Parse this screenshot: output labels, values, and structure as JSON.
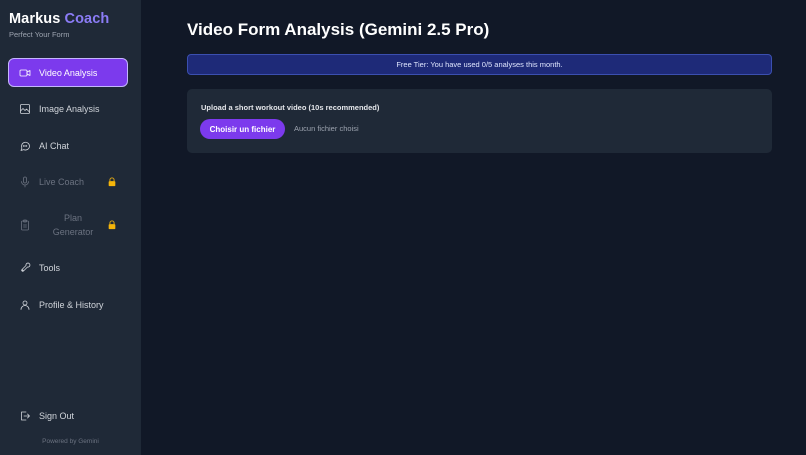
{
  "brand": {
    "name": "Markus",
    "accent": "Coach",
    "tagline": "Perfect Your Form"
  },
  "sidebar": {
    "items": [
      {
        "label": "Video Analysis",
        "icon": "video-icon",
        "active": true,
        "locked": false
      },
      {
        "label": "Image Analysis",
        "icon": "image-icon",
        "active": false,
        "locked": false
      },
      {
        "label": "AI Chat",
        "icon": "chat-bubble-icon",
        "active": false,
        "locked": false
      },
      {
        "label": "Live Coach",
        "icon": "microphone-icon",
        "active": false,
        "locked": true
      },
      {
        "label": "Plan Generator",
        "label_line1": "Plan",
        "label_line2": "Generator",
        "icon": "clipboard-icon",
        "active": false,
        "locked": true
      },
      {
        "label": "Tools",
        "icon": "tools-icon",
        "active": false,
        "locked": false
      },
      {
        "label": "Profile & History",
        "icon": "user-icon",
        "active": false,
        "locked": false
      }
    ],
    "sign_out": "Sign Out",
    "powered_by": "Powered by Gemini"
  },
  "main": {
    "title": "Video Form Analysis (Gemini 2.5 Pro)",
    "banner": "Free Tier: You have used 0/5 analyses this month.",
    "upload": {
      "label": "Upload a short workout video (10s recommended)",
      "button_label": "Choisir un fichier",
      "file_status": "Aucun fichier choisi"
    }
  },
  "colors": {
    "background": "#111827",
    "sidebar": "#1f2937",
    "accent": "#7c3aed",
    "brand_accent": "#8b7cf6",
    "lock": "#f5b50a",
    "banner_bg": "#1e2a78"
  }
}
